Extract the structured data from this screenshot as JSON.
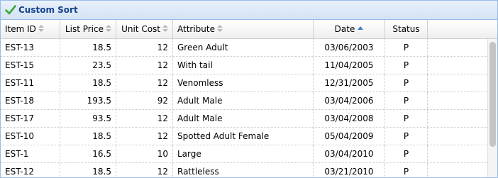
{
  "title": "Custom Sort",
  "columns": [
    {
      "label": "Item ID",
      "sort": "none"
    },
    {
      "label": "List Price",
      "sort": "none"
    },
    {
      "label": "Unit Cost",
      "sort": "none"
    },
    {
      "label": "Attribute",
      "sort": "none"
    },
    {
      "label": "Date",
      "sort": "ascending"
    },
    {
      "label": "Status",
      "sort": "none"
    }
  ],
  "rows": [
    {
      "item_id": "EST-13",
      "list_price": "18.5",
      "unit_cost": "12",
      "attribute": "Green Adult",
      "date": "03/06/2003",
      "status": "P"
    },
    {
      "item_id": "EST-15",
      "list_price": "23.5",
      "unit_cost": "12",
      "attribute": "With tail",
      "date": "11/04/2005",
      "status": "P"
    },
    {
      "item_id": "EST-11",
      "list_price": "18.5",
      "unit_cost": "12",
      "attribute": "Venomless",
      "date": "12/31/2005",
      "status": "P"
    },
    {
      "item_id": "EST-18",
      "list_price": "193.5",
      "unit_cost": "92",
      "attribute": "Adult Male",
      "date": "03/04/2006",
      "status": "P"
    },
    {
      "item_id": "EST-17",
      "list_price": "93.5",
      "unit_cost": "12",
      "attribute": "Adult Male",
      "date": "03/04/2008",
      "status": "P"
    },
    {
      "item_id": "EST-10",
      "list_price": "18.5",
      "unit_cost": "12",
      "attribute": "Spotted Adult Female",
      "date": "05/04/2009",
      "status": "P"
    },
    {
      "item_id": "EST-1",
      "list_price": "16.5",
      "unit_cost": "10",
      "attribute": "Large",
      "date": "03/04/2010",
      "status": "P"
    },
    {
      "item_id": "EST-12",
      "list_price": "18.5",
      "unit_cost": "12",
      "attribute": "Rattleless",
      "date": "03/21/2010",
      "status": "P"
    }
  ],
  "colors": {
    "title_text": "#15428b",
    "panel_border": "#99bbe8",
    "sort_active": "#3d7bc6",
    "check_icon": "#3aa832"
  },
  "icons": {
    "title": "check-icon",
    "sortable": "sort-icon",
    "sorted_asc": "sort-ascending-icon"
  }
}
